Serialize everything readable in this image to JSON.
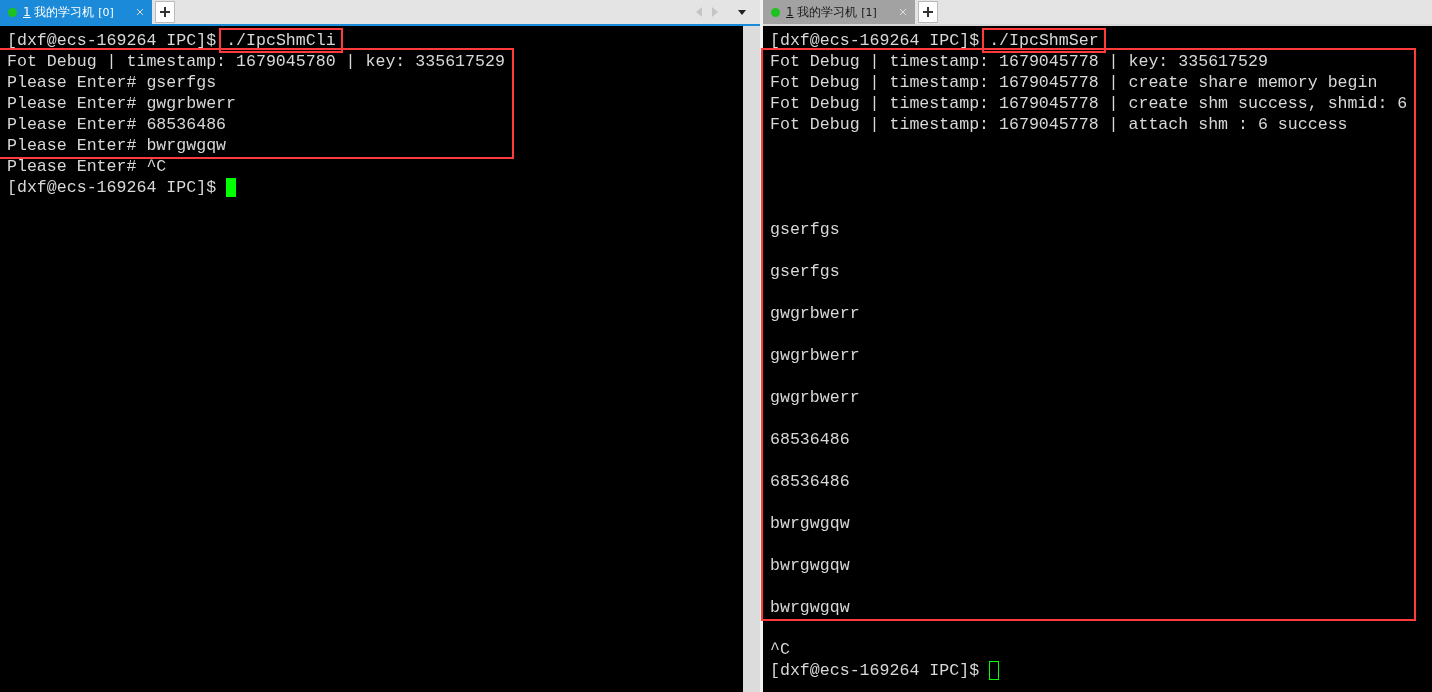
{
  "panes": [
    {
      "tab": {
        "number": "1",
        "label": "我的学习机",
        "index": "[0]",
        "selected": true
      },
      "nav_controls": true,
      "scrollbar": true,
      "blocks": [
        {
          "highlighted": false,
          "lines": [
            {
              "kind": "command",
              "prompt": "[dxf@ecs-169264 IPC]$",
              "command": "./IpcShmCli",
              "highlighted": true
            }
          ]
        },
        {
          "highlighted": true,
          "lines": [
            {
              "kind": "text",
              "text": "Fot Debug | timestamp: 1679045780 | key: 335617529"
            },
            {
              "kind": "text",
              "text": "Please Enter# gserfgs"
            },
            {
              "kind": "text",
              "text": "Please Enter# gwgrbwerr"
            },
            {
              "kind": "text",
              "text": "Please Enter# 68536486"
            },
            {
              "kind": "text",
              "text": "Please Enter# bwrgwgqw"
            }
          ]
        },
        {
          "highlighted": false,
          "lines": [
            {
              "kind": "text",
              "text": "Please Enter# ^C"
            },
            {
              "kind": "prompt",
              "prompt": "[dxf@ecs-169264 IPC]$",
              "cursor_focused": true
            }
          ]
        }
      ]
    },
    {
      "tab": {
        "number": "1",
        "label": "我的学习机",
        "index": "[1]",
        "selected": false
      },
      "nav_controls": false,
      "scrollbar": false,
      "blocks": [
        {
          "highlighted": false,
          "lines": [
            {
              "kind": "command",
              "prompt": "[dxf@ecs-169264 IPC]$",
              "command": "./IpcShmSer",
              "highlighted": true
            }
          ]
        },
        {
          "highlighted": true,
          "lines": [
            {
              "kind": "text",
              "text": "Fot Debug | timestamp: 1679045778 | key: 335617529"
            },
            {
              "kind": "text",
              "text": "Fot Debug | timestamp: 1679045778 | create share memory begin"
            },
            {
              "kind": "text",
              "text": "Fot Debug | timestamp: 1679045778 | create shm success, shmid: 6"
            },
            {
              "kind": "text",
              "text": "Fot Debug | timestamp: 1679045778 | attach shm : 6 success"
            },
            {
              "kind": "blank"
            },
            {
              "kind": "blank"
            },
            {
              "kind": "blank"
            },
            {
              "kind": "blank"
            },
            {
              "kind": "text",
              "text": "gserfgs"
            },
            {
              "kind": "blank"
            },
            {
              "kind": "text",
              "text": "gserfgs"
            },
            {
              "kind": "blank"
            },
            {
              "kind": "text",
              "text": "gwgrbwerr"
            },
            {
              "kind": "blank"
            },
            {
              "kind": "text",
              "text": "gwgrbwerr"
            },
            {
              "kind": "blank"
            },
            {
              "kind": "text",
              "text": "gwgrbwerr"
            },
            {
              "kind": "blank"
            },
            {
              "kind": "text",
              "text": "68536486"
            },
            {
              "kind": "blank"
            },
            {
              "kind": "text",
              "text": "68536486"
            },
            {
              "kind": "blank"
            },
            {
              "kind": "text",
              "text": "bwrgwgqw"
            },
            {
              "kind": "blank"
            },
            {
              "kind": "text",
              "text": "bwrgwgqw"
            },
            {
              "kind": "blank"
            },
            {
              "kind": "text",
              "text": "bwrgwgqw"
            }
          ]
        },
        {
          "highlighted": false,
          "lines": [
            {
              "kind": "blank"
            },
            {
              "kind": "text",
              "text": "^C"
            },
            {
              "kind": "prompt",
              "prompt": "[dxf@ecs-169264 IPC]$",
              "cursor_focused": false
            }
          ]
        }
      ]
    }
  ]
}
